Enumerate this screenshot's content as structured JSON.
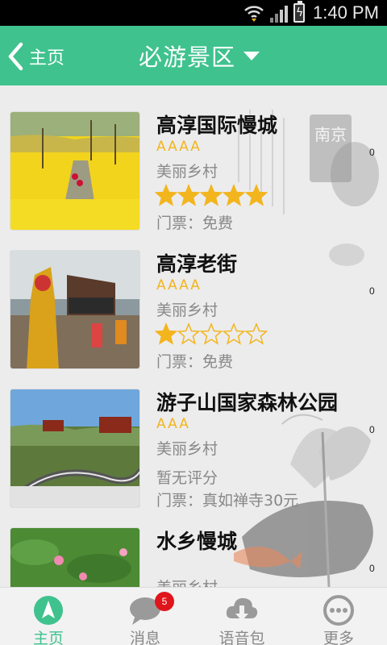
{
  "status_bar": {
    "time": "1:40 PM"
  },
  "header": {
    "back_label": "主页",
    "title": "必游景区"
  },
  "list": [
    {
      "name": "高淳国际慢城",
      "grade": "AAAA",
      "category": "美丽乡村",
      "rating": 5,
      "ticket": "门票：免费",
      "count": "0"
    },
    {
      "name": "高淳老街",
      "grade": "AAAA",
      "category": "美丽乡村",
      "rating": 1,
      "ticket": "门票：免费",
      "count": "0"
    },
    {
      "name": "游子山国家森林公园",
      "grade": "AAA",
      "category": "美丽乡村",
      "rating_text": "暂无评分",
      "ticket": "门票：真如禅寺30元",
      "count": "0"
    },
    {
      "name": "水乡慢城",
      "grade": "",
      "category": "美丽乡村",
      "count": "0"
    }
  ],
  "watermark": {
    "seal_text": "南京"
  },
  "tabs": [
    {
      "label": "主页",
      "icon": "compass-icon",
      "active": true
    },
    {
      "label": "消息",
      "icon": "message-icon",
      "badge": "5"
    },
    {
      "label": "语音包",
      "icon": "download-cloud-icon"
    },
    {
      "label": "更多",
      "icon": "more-icon"
    }
  ],
  "colors": {
    "accent": "#3fc28e",
    "star": "#f2b51e",
    "badge": "#e0141b"
  }
}
